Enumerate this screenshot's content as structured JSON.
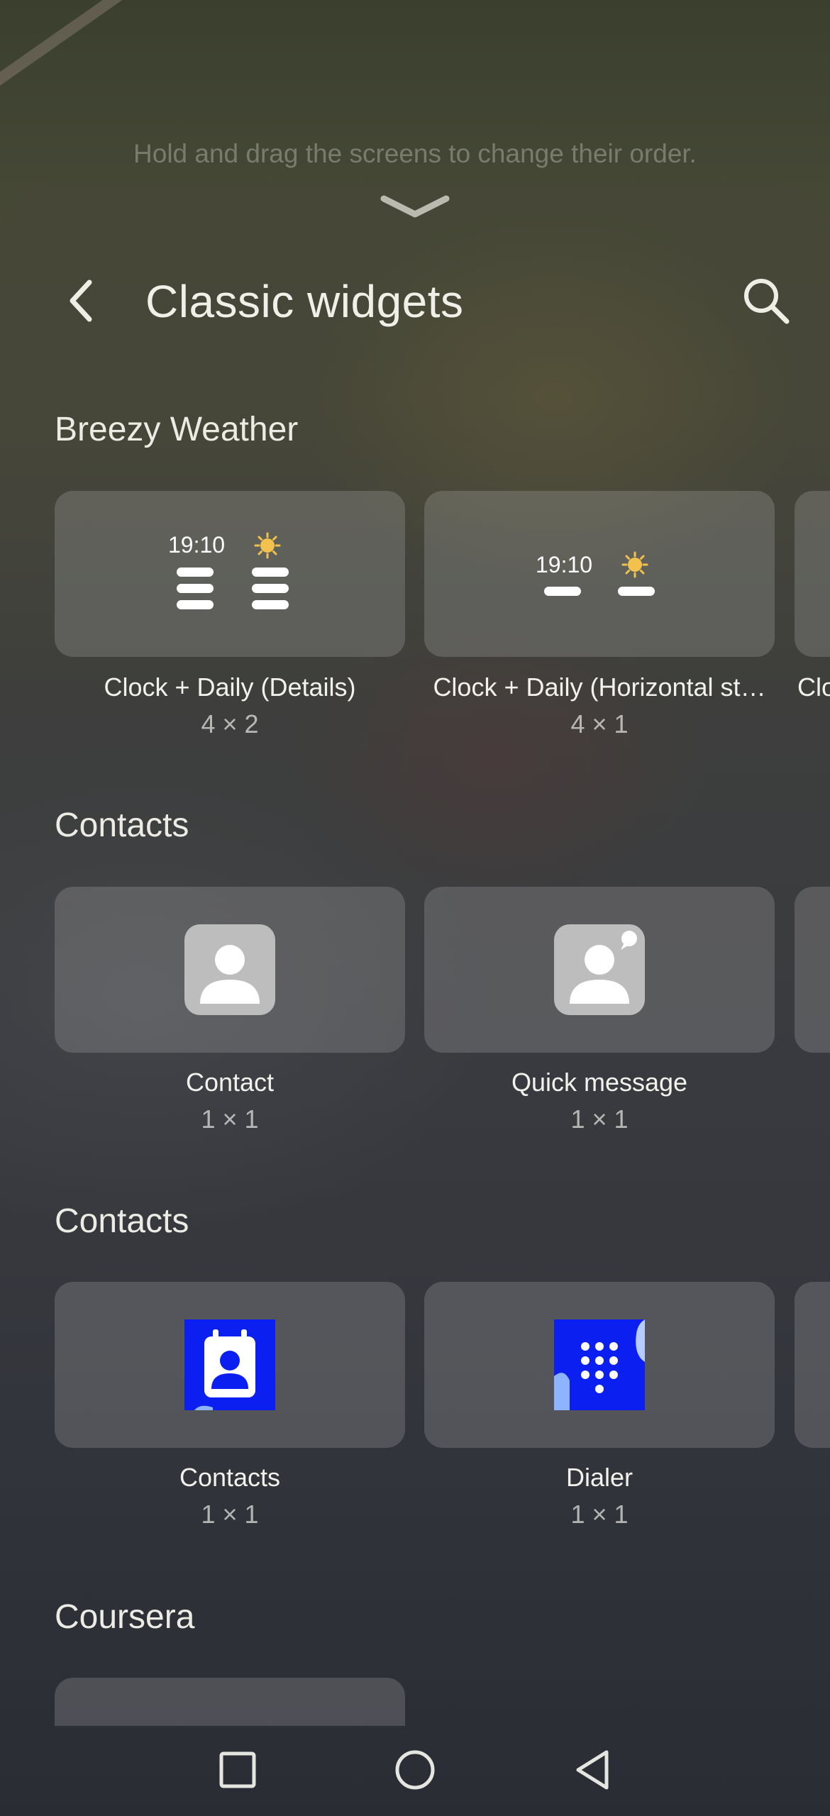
{
  "hint_text": "Hold and drag the screens to change their order.",
  "header": {
    "title": "Classic widgets"
  },
  "sections": [
    {
      "title": "Breezy Weather",
      "widgets": [
        {
          "name": "Clock + Daily (Details)",
          "size": "4 × 2",
          "preview_time": "19:10"
        },
        {
          "name": "Clock + Daily (Horizontal st…",
          "size": "4 × 1",
          "preview_time": "19:10"
        },
        {
          "name": "Clo"
        }
      ]
    },
    {
      "title": "Contacts",
      "widgets": [
        {
          "name": "Contact",
          "size": "1 × 1"
        },
        {
          "name": "Quick message",
          "size": "1 × 1"
        }
      ]
    },
    {
      "title": "Contacts",
      "widgets": [
        {
          "name": "Contacts",
          "size": "1 × 1"
        },
        {
          "name": "Dialer",
          "size": "1 × 1"
        }
      ]
    },
    {
      "title": "Coursera",
      "widgets": []
    }
  ],
  "colors": {
    "contacts_app_blue": "#0b1ff0",
    "sun_yellow": "#f2c14e",
    "contact_icon_grey": "#bdbdbd"
  },
  "icons": [
    "chevron-down-icon",
    "back-arrow-icon",
    "search-icon",
    "sun-icon",
    "contact-icon",
    "quick-message-icon",
    "contacts-app-icon",
    "dialer-app-icon",
    "recents-icon",
    "home-icon",
    "back-icon"
  ]
}
